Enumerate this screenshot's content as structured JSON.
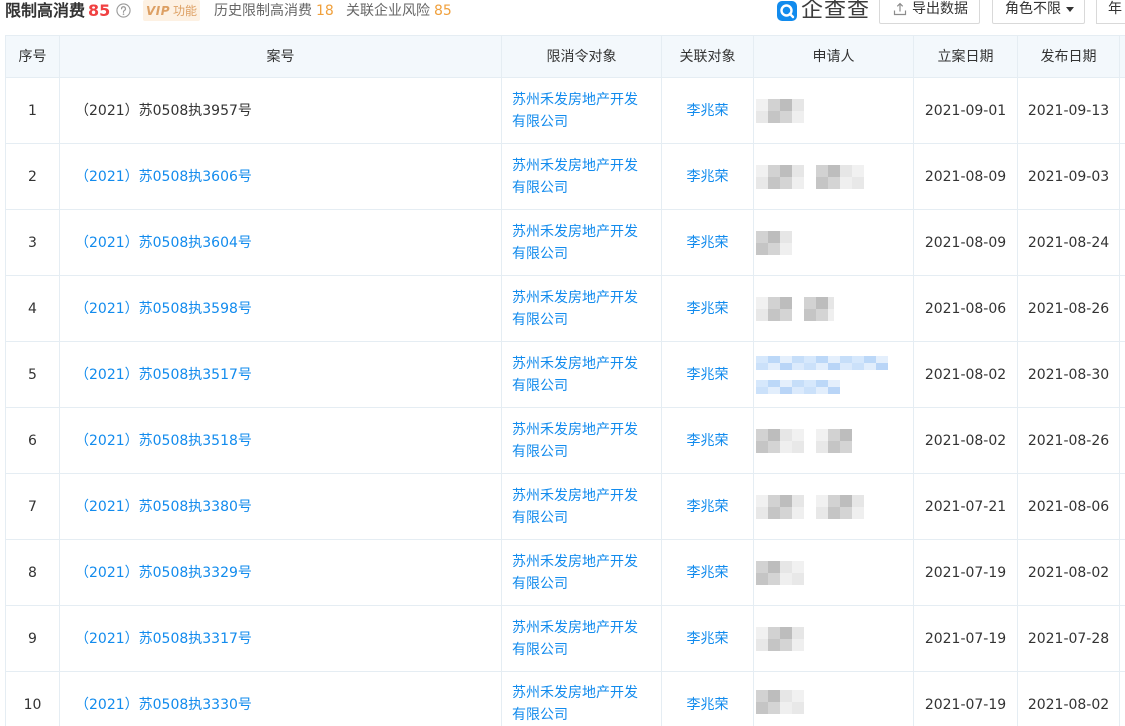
{
  "header": {
    "title": "限制高消费",
    "title_count": "85",
    "vip_badge": {
      "mark": "VIP",
      "label": "功能"
    },
    "history": {
      "label": "历史限制高消费",
      "count": "18"
    },
    "related_risk": {
      "label": "关联企业风险",
      "count": "85"
    },
    "brand": {
      "name": "企查查"
    },
    "export_button": "导出数据",
    "role_filter": "角色不限",
    "year_filter": "年"
  },
  "icons": {
    "help": "help-icon",
    "logo": "qichacha-logo-icon",
    "export": "export-icon",
    "role_dropdown": "caret-down-icon"
  },
  "colors": {
    "link": "#128bed",
    "title_count": "#f04142",
    "badge_count": "#f0a03c",
    "vip_text": "#dda064",
    "vip_bg": "#fdf1e3",
    "table_header_bg": "#f3f8fc"
  },
  "table": {
    "columns": [
      "序号",
      "案号",
      "限消令对象",
      "关联对象",
      "申请人",
      "立案日期",
      "发布日期"
    ],
    "rows": [
      {
        "index": "1",
        "case_no": "（2021）苏0508执3957号",
        "target": "苏州禾发房地产开发有限公司",
        "related": "李兆荣",
        "filed": "2021-09-01",
        "published": "2021-09-13"
      },
      {
        "index": "2",
        "case_no": "（2021）苏0508执3606号",
        "target": "苏州禾发房地产开发有限公司",
        "related": "李兆荣",
        "filed": "2021-08-09",
        "published": "2021-09-03"
      },
      {
        "index": "3",
        "case_no": "（2021）苏0508执3604号",
        "target": "苏州禾发房地产开发有限公司",
        "related": "李兆荣",
        "filed": "2021-08-09",
        "published": "2021-08-24"
      },
      {
        "index": "4",
        "case_no": "（2021）苏0508执3598号",
        "target": "苏州禾发房地产开发有限公司",
        "related": "李兆荣",
        "filed": "2021-08-06",
        "published": "2021-08-26"
      },
      {
        "index": "5",
        "case_no": "（2021）苏0508执3517号",
        "target": "苏州禾发房地产开发有限公司",
        "related": "李兆荣",
        "filed": "2021-08-02",
        "published": "2021-08-30"
      },
      {
        "index": "6",
        "case_no": "（2021）苏0508执3518号",
        "target": "苏州禾发房地产开发有限公司",
        "related": "李兆荣",
        "filed": "2021-08-02",
        "published": "2021-08-26"
      },
      {
        "index": "7",
        "case_no": "（2021）苏0508执3380号",
        "target": "苏州禾发房地产开发有限公司",
        "related": "李兆荣",
        "filed": "2021-07-21",
        "published": "2021-08-06"
      },
      {
        "index": "8",
        "case_no": "（2021）苏0508执3329号",
        "target": "苏州禾发房地产开发有限公司",
        "related": "李兆荣",
        "filed": "2021-07-19",
        "published": "2021-08-02"
      },
      {
        "index": "9",
        "case_no": "（2021）苏0508执3317号",
        "target": "苏州禾发房地产开发有限公司",
        "related": "李兆荣",
        "filed": "2021-07-19",
        "published": "2021-07-28"
      },
      {
        "index": "10",
        "case_no": "（2021）苏0508执3330号",
        "target": "苏州禾发房地产开发有限公司",
        "related": "李兆荣",
        "filed": "2021-07-19",
        "published": "2021-08-02"
      }
    ]
  }
}
